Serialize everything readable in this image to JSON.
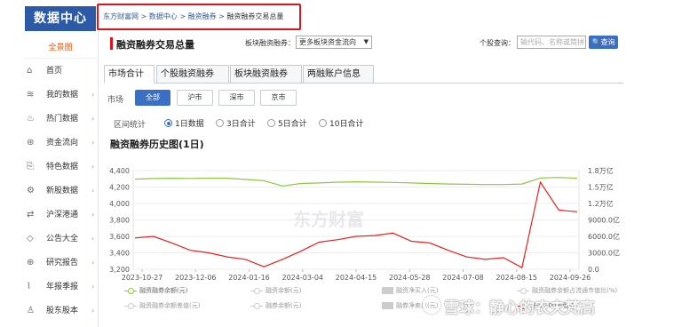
{
  "sidebar": {
    "title": "数据中心",
    "overview": "全景图",
    "items": [
      {
        "label": "首页",
        "icon": "home-icon",
        "arrow": ""
      },
      {
        "label": "我的数据",
        "icon": "layers-icon",
        "arrow": "›"
      },
      {
        "label": "热门数据",
        "icon": "fire-icon",
        "arrow": "›"
      },
      {
        "label": "资金流向",
        "icon": "money-flow-icon",
        "arrow": "›"
      },
      {
        "label": "特色数据",
        "icon": "bookmark-icon",
        "arrow": "›"
      },
      {
        "label": "新股数据",
        "icon": "gear-icon",
        "arrow": "›"
      },
      {
        "label": "沪深港通",
        "icon": "exchange-icon",
        "arrow": "›"
      },
      {
        "label": "公告大全",
        "icon": "megaphone-icon",
        "arrow": "›"
      },
      {
        "label": "研究报告",
        "icon": "globe-icon",
        "arrow": "›"
      },
      {
        "label": "年报季报",
        "icon": "line-chart-icon",
        "arrow": "›"
      },
      {
        "label": "股东股本",
        "icon": "person-icon",
        "arrow": "›"
      }
    ]
  },
  "breadcrumb": {
    "items": [
      "东方财富网",
      "数据中心",
      "融资融券"
    ],
    "sep": " > ",
    "current": "融资融券交易总量"
  },
  "header": {
    "title": "融资融券交易总量",
    "block_label": "板块融资融券：",
    "block_select": "更多板块资金流向",
    "stock_label": "个股查询：",
    "stock_placeholder": "输代码、名称或简拼",
    "query_button": "查询"
  },
  "tabs": [
    "市场合计",
    "个股融资融券",
    "板块融资融券",
    "两融账户信息"
  ],
  "market": {
    "label": "市场",
    "options": [
      "全部",
      "沪市",
      "深市",
      "京市"
    ],
    "selected": "全部"
  },
  "interval": {
    "label": "区间统计",
    "options": [
      "1日数据",
      "3日合计",
      "5日合计",
      "10日合计"
    ],
    "selected": "1日数据"
  },
  "history_title": "融资融券历史图(1日)",
  "watermark": {
    "text": "雪球：静心的农夫梵高",
    "chart_mark": "东方财富"
  },
  "colors": {
    "green_series": "#8fc641",
    "red_series": "#e8211c",
    "accent": "#3a6fc4",
    "brand": "#2d5aa6",
    "highlight_box": "#e0121b"
  },
  "chart_data": {
    "type": "line",
    "x_ticks": [
      "2023-10-27",
      "2023-12-06",
      "2024-01-16",
      "2024-03-04",
      "2024-04-15",
      "2024-05-28",
      "2024-07-08",
      "2024-08-15",
      "2024-09-26"
    ],
    "left_axis": {
      "ticks": [
        "4,400",
        "4,200",
        "4,000",
        "3,800",
        "3,600",
        "3,400",
        "3,200"
      ],
      "ylim": [
        3200,
        4400
      ]
    },
    "right_axis": {
      "ticks": [
        "1.8万亿",
        "1.5万亿",
        "1.2万亿",
        "9000.0亿",
        "6000.0亿",
        "3000.0亿",
        "0.0"
      ],
      "ylim": [
        0,
        18000
      ]
    },
    "series": [
      {
        "name": "融资融券余额(元)",
        "axis": "right",
        "color": "#8fc641",
        "values": [
          16450,
          16550,
          16600,
          16580,
          16620,
          16600,
          16400,
          16150,
          15200,
          15650,
          15750,
          15900,
          15950,
          15900,
          15850,
          15750,
          15650,
          15550,
          15500,
          15450,
          15450,
          15550,
          16650,
          16750,
          16600
        ]
      },
      {
        "name": "沪深300收盘价",
        "axis": "left",
        "color": "#e8211c",
        "values": [
          3580,
          3600,
          3520,
          3430,
          3400,
          3350,
          3320,
          3230,
          3320,
          3420,
          3530,
          3560,
          3600,
          3610,
          3640,
          3540,
          3520,
          3430,
          3350,
          3320,
          3340,
          3220,
          4260,
          3920,
          3900
        ]
      }
    ],
    "legend": [
      {
        "name": "融资融券余额(元)",
        "kind": "line",
        "color": "#8fc641",
        "active": true
      },
      {
        "name": "融资余额(元)",
        "kind": "line",
        "color": "#cccccc",
        "active": false
      },
      {
        "name": "融资净买入(元)",
        "kind": "box",
        "color": "#cccccc",
        "active": false
      },
      {
        "name": "融资融券余额占流通市值比(%)",
        "kind": "line",
        "color": "#cccccc",
        "active": false
      },
      {
        "name": "融资融券余额差值(元)",
        "kind": "line",
        "color": "#cccccc",
        "active": false
      },
      {
        "name": "融券余额(元)",
        "kind": "line",
        "color": "#cccccc",
        "active": false
      },
      {
        "name": "融券净卖出(元)",
        "kind": "box",
        "color": "#cccccc",
        "active": false
      },
      {
        "name": "沪深300收盘价",
        "kind": "line",
        "color": "#e8211c",
        "active": true
      }
    ],
    "grid": true
  }
}
